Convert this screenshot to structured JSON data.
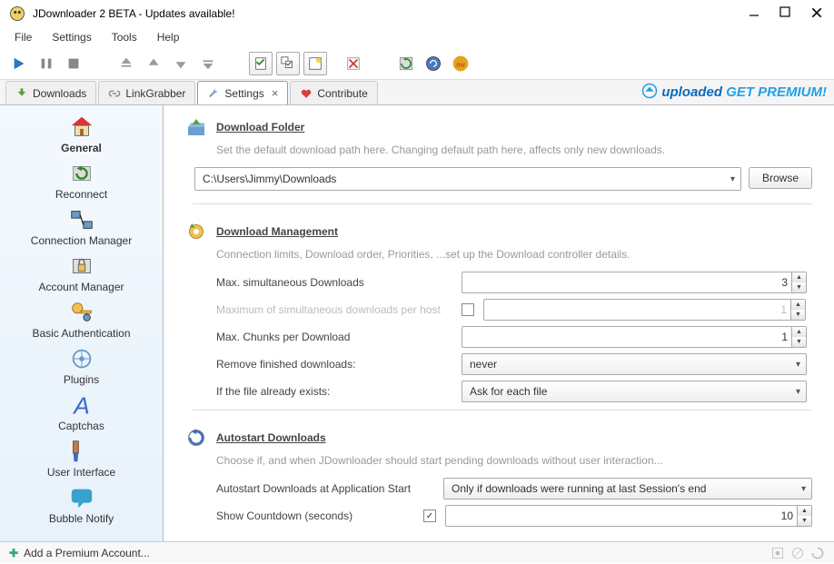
{
  "window": {
    "title": "JDownloader 2 BETA - Updates available!"
  },
  "menu": {
    "file": "File",
    "settings": "Settings",
    "tools": "Tools",
    "help": "Help"
  },
  "tabs": {
    "downloads": "Downloads",
    "linkgrabber": "LinkGrabber",
    "settings": "Settings",
    "contribute": "Contribute"
  },
  "promo": {
    "brand": "uploaded",
    "cta": "GET PREMIUM!"
  },
  "sidebar": {
    "items": [
      {
        "label": "General"
      },
      {
        "label": "Reconnect"
      },
      {
        "label": "Connection Manager"
      },
      {
        "label": "Account Manager"
      },
      {
        "label": "Basic Authentication"
      },
      {
        "label": "Plugins"
      },
      {
        "label": "Captchas"
      },
      {
        "label": "User Interface"
      },
      {
        "label": "Bubble Notify"
      }
    ]
  },
  "sections": {
    "folder": {
      "title": "Download Folder",
      "desc": "Set the default download path here. Changing default path here, affects only new downloads.",
      "path": "C:\\Users\\Jimmy\\Downloads",
      "browse": "Browse"
    },
    "mgmt": {
      "title": "Download Management",
      "desc": "Connection limits, Download order, Priorities, ...set up the Download controller details.",
      "max_sim_label": "Max. simultaneous Downloads",
      "max_sim_value": "3",
      "max_per_host_label": "Maximum of simultaneous downloads per host",
      "max_per_host_value": "1",
      "max_chunks_label": "Max. Chunks per Download",
      "max_chunks_value": "1",
      "remove_label": "Remove finished downloads:",
      "remove_value": "never",
      "exists_label": "If the file already exists:",
      "exists_value": "Ask for each file"
    },
    "auto": {
      "title": "Autostart Downloads",
      "desc": "Choose if, and when JDownloader should start pending downloads without user interaction...",
      "start_label": "Autostart Downloads at Application Start",
      "start_value": "Only if downloads were running at last Session's end",
      "countdown_label": "Show Countdown (seconds)",
      "countdown_value": "10"
    }
  },
  "status": {
    "add_account": "Add a Premium Account..."
  }
}
